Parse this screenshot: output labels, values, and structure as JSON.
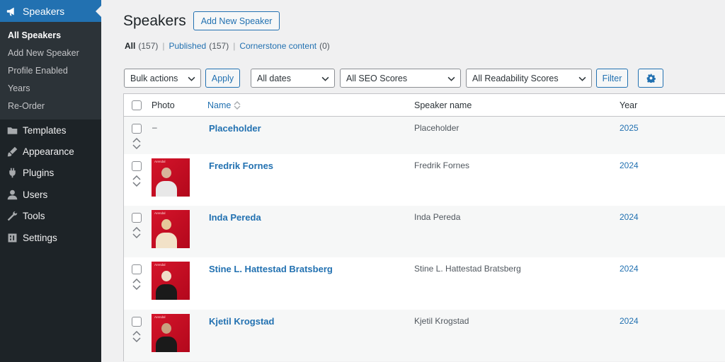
{
  "sidebar": {
    "current": {
      "label": "Speakers",
      "icon": "megaphone-icon"
    },
    "submenu": [
      {
        "label": "All Speakers",
        "active": true
      },
      {
        "label": "Add New Speaker",
        "active": false
      },
      {
        "label": "Profile Enabled",
        "active": false
      },
      {
        "label": "Years",
        "active": false
      },
      {
        "label": "Re-Order",
        "active": false
      }
    ],
    "items": [
      {
        "label": "Templates",
        "icon": "folder-icon"
      },
      {
        "label": "Appearance",
        "icon": "brush-icon"
      },
      {
        "label": "Plugins",
        "icon": "plug-icon"
      },
      {
        "label": "Users",
        "icon": "user-icon"
      },
      {
        "label": "Tools",
        "icon": "wrench-icon"
      },
      {
        "label": "Settings",
        "icon": "settings-icon"
      }
    ]
  },
  "header": {
    "title": "Speakers",
    "add_new_label": "Add New Speaker"
  },
  "filters_links": {
    "all_label": "All",
    "all_count": "(157)",
    "published_label": "Published",
    "published_count": "(157)",
    "cornerstone_label": "Cornerstone content",
    "cornerstone_count": "(0)",
    "separator": "|"
  },
  "toolbar": {
    "bulk_actions": "Bulk actions",
    "apply_label": "Apply",
    "dates": "All dates",
    "seo": "All SEO Scores",
    "readability": "All Readability Scores",
    "filter_label": "Filter",
    "settings_icon": "gear-icon"
  },
  "table": {
    "columns": {
      "photo": "Photo",
      "name": "Name",
      "speaker": "Speaker name",
      "year": "Year"
    },
    "rows": [
      {
        "photo": "–",
        "name": "Placeholder",
        "speaker": "Placeholder",
        "year": "2025"
      },
      {
        "photo_tag": "Arendal",
        "name": "Fredrik Fornes",
        "speaker": "Fredrik Fornes",
        "year": "2024"
      },
      {
        "photo_tag": "Arendal",
        "name": "Inda Pereda",
        "speaker": "Inda Pereda",
        "year": "2024"
      },
      {
        "photo_tag": "Arendal",
        "name": "Stine L. Hattestad Bratsberg",
        "speaker": "Stine L. Hattestad Bratsberg",
        "year": "2024"
      },
      {
        "photo_tag": "Arendal",
        "name": "Kjetil Krogstad",
        "speaker": "Kjetil Krogstad",
        "year": "2024"
      }
    ]
  },
  "colors": {
    "accent": "#2271b1",
    "sidebar": "#1d2327",
    "photo_bg": "#d4142a"
  }
}
